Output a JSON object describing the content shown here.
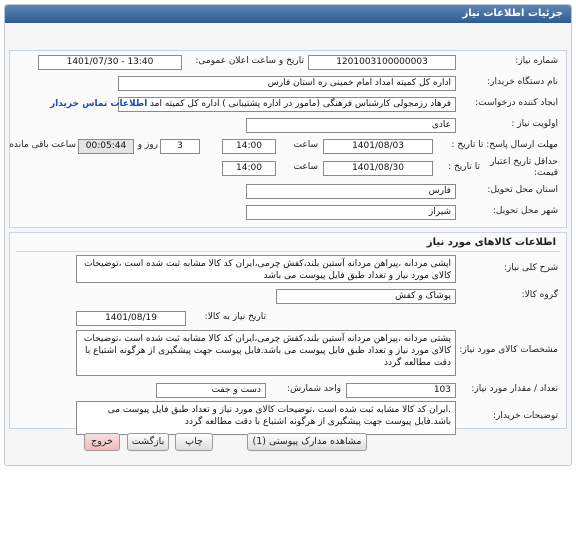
{
  "header": {
    "title": "جزئیات اطلاعات نیاز"
  },
  "need_info": {
    "need_number_label": "شماره نیاز:",
    "need_number": "1201003100000003",
    "announce_label": "تاریخ و ساعت اعلان عمومی:",
    "announce_value": "1401/07/30 - 13:40",
    "buyer_label": "نام دستگاه خریدار:",
    "buyer_value": "اداره کل کمیته امداد امام خمینی  ره  استان فارس",
    "creator_label": "ایجاد کننده درخواست:",
    "creator_value": "فرهاد رزمجولی کارشناس فرهنگی (مامور در اداره پشتیبانی ) اداره کل کمیته امد",
    "contact_link": "اطلاعات تماس خریدار",
    "priority_label": "اولویت نیاز :",
    "priority_value": "عادی",
    "deadline_label": "مهلت ارسال پاسخ: تا تاریخ :",
    "deadline_date": "1401/08/03",
    "time_label": "ساعت",
    "deadline_time": "14:00",
    "days_value": "3",
    "days_label": "روز و",
    "remaining_value": "00:05:44",
    "remaining_label": "ساعت باقی مانده",
    "validity_label_1": "حداقل تاریخ اعتبار",
    "validity_label_2": "قیمت:",
    "validity_to": "تا تاریخ :",
    "validity_date": "1401/08/30",
    "validity_time": "14:00",
    "province_label": "استان محل تحویل:",
    "province_value": "فارس",
    "city_label": "شهر محل تحویل:",
    "city_value": "شیراز"
  },
  "goods": {
    "section_title": "اطلاعات کالاهای مورد نیاز",
    "desc_label": "شرح کلی نیاز:",
    "desc_value": "اپشی مردانه  ،پیراهن مردانه آستین بلند،کفش چرمی،ایران کد کالا مشابه ثبت شده است ،توضیحات کالای مورد نیاز و تعداد طبق فایل پیوست می باشد",
    "group_label": "گروه کالا:",
    "group_value": "پوشاک و کفش",
    "need_date_label": "تاریخ نیاز به کالا:",
    "need_date_value": "1401/08/19",
    "spec_label": "مشخصات کالای مورد نیاز:",
    "spec_value": "پشتی مردانه  ،پیراهن مردانه آستین بلند،کفش چرمی،ایران کد کالا مشابه ثبت شده است ،توضیحات کالای مورد نیاز و تعداد طبق فایل پیوست می باشد.فایل پیوست جهت پیشگیری از هرگونه اشتباع با دقت مطالعه گردد",
    "qty_label": "تعداد / مقدار مورد نیاز:",
    "qty_value": "103",
    "unit_label": "واحد شمارش:",
    "unit_value": "دست و جفت",
    "buyer_notes_label": "توضیحات خریدار:",
    "buyer_notes_value": ".ایران کد کالا مشابه ثبت شده است ،توضیحات کالای مورد نیاز و تعداد طبق فایل پیوست می باشد.فایل پیوست جهت پیشگیری از هرگونه اشتباع با دقت مطالعه گردد"
  },
  "buttons": {
    "attachments": "مشاهده مدارک پیوستی (1)",
    "print": "چاپ",
    "back": "بازگشت",
    "exit": "خروج"
  },
  "colors": {
    "header_bg": "#3a6699",
    "link": "#1a4fb3",
    "exit_bg": "#f2c9c9"
  }
}
